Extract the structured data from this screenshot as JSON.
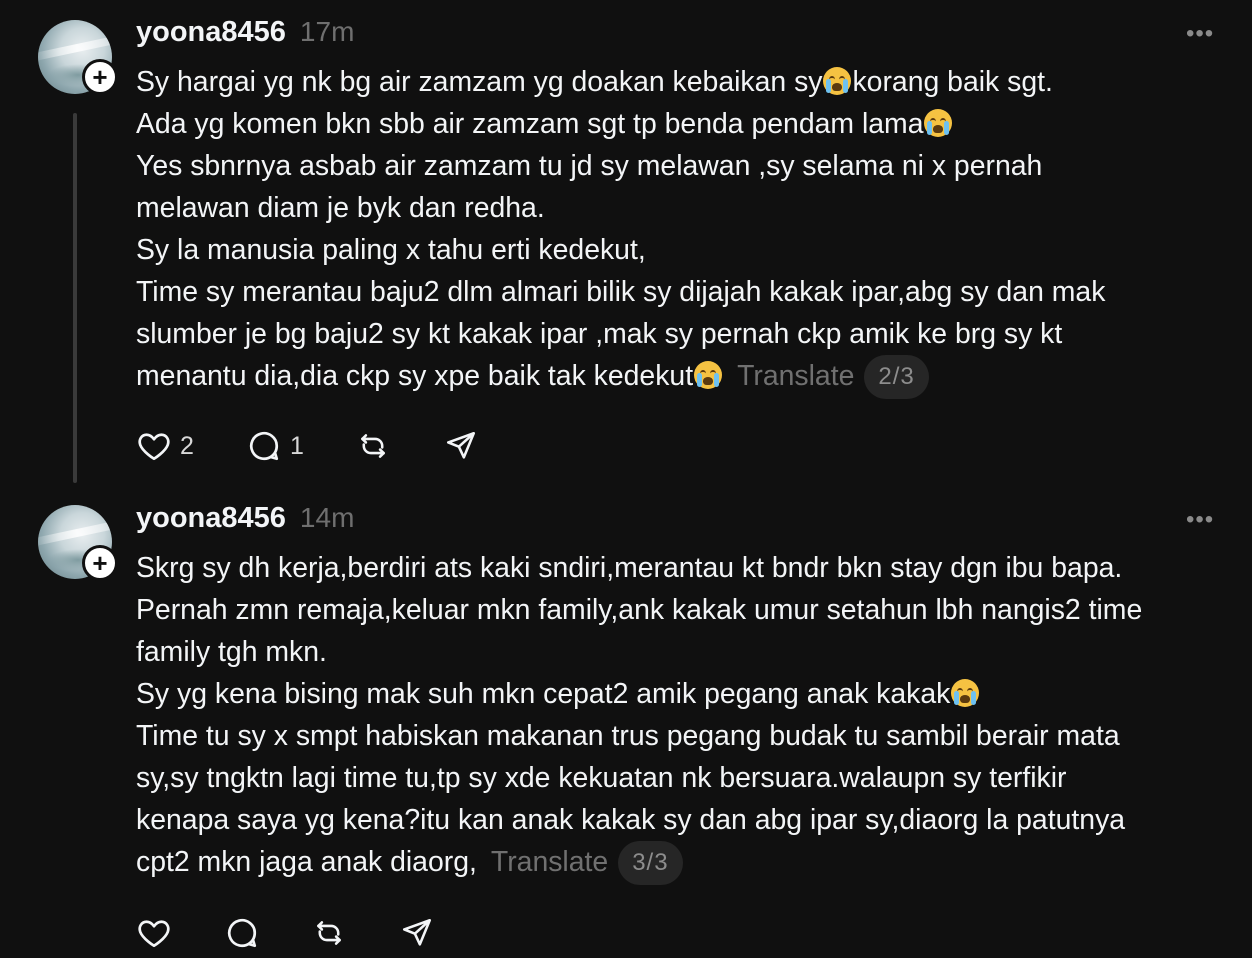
{
  "posts": [
    {
      "username": "yoona8456",
      "time": "17m",
      "lines": [
        [
          "Sy hargai yg nk bg air zamzam yg doakan kebaikan sy",
          ":cry:",
          "korang baik sgt."
        ],
        [
          "Ada yg komen bkn sbb air zamzam sgt tp benda pendam lama",
          ":cry:"
        ],
        [
          "Yes sbnrnya asbab air zamzam tu jd sy melawan ,sy selama ni x pernah"
        ],
        [
          "melawan diam je byk dan redha."
        ],
        [
          "Sy la manusia paling x tahu erti kedekut,"
        ],
        [
          "Time sy merantau baju2 dlm almari bilik sy dijajah kakak ipar,abg sy dan mak"
        ],
        [
          "slumber je bg baju2 sy kt kakak ipar ,mak sy pernah ckp amik ke brg sy kt"
        ],
        [
          "menantu dia,dia ckp sy xpe baik tak kedekut",
          ":cry:"
        ]
      ],
      "translate_label": "Translate",
      "page": "2/3",
      "like_count": "2",
      "reply_count": "1"
    },
    {
      "username": "yoona8456",
      "time": "14m",
      "lines": [
        [
          "Skrg sy dh kerja,berdiri ats kaki sndiri,merantau kt bndr bkn stay dgn ibu bapa."
        ],
        [
          "Pernah zmn remaja,keluar mkn family,ank kakak umur setahun lbh nangis2 time"
        ],
        [
          "family tgh mkn."
        ],
        [
          "Sy yg kena bising mak suh mkn cepat2 amik pegang anak kakak",
          ":cry:"
        ],
        [
          "Time tu sy x smpt habiskan makanan trus pegang budak tu sambil berair mata"
        ],
        [
          "sy,sy tngktn lagi time tu,tp sy xde kekuatan nk bersuara.walaupn sy terfikir"
        ],
        [
          "kenapa saya yg kena?itu kan anak kakak sy dan abg ipar sy,diaorg la patutnya"
        ],
        [
          "cpt2 mkn jaga anak diaorg,"
        ]
      ],
      "translate_label": "Translate",
      "page": "3/3",
      "like_count": "",
      "reply_count": ""
    }
  ],
  "icons": {
    "more": "more-horizontal-icon",
    "like": "heart-icon",
    "reply": "comment-bubble-icon",
    "repost": "repost-icon",
    "share": "send-icon",
    "emoji": "loudly-crying-face-emoji"
  },
  "colors": {
    "background": "#101010",
    "text": "#f3f5f7",
    "muted": "#707070",
    "badge_bg": "#262626"
  }
}
